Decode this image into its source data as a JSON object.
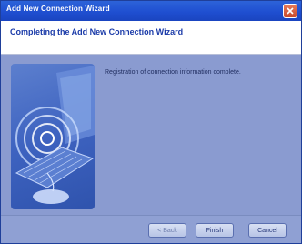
{
  "window": {
    "title": "Add New Connection Wizard"
  },
  "header": {
    "title": "Completing the Add New Connection Wizard"
  },
  "content": {
    "message": "Registration of connection information complete."
  },
  "buttons": {
    "back": "< Back",
    "finish": "Finish",
    "cancel": "Cancel"
  },
  "colors": {
    "titlebar": "#1f4fd1",
    "header_title": "#1a3aa8",
    "content_bg": "#8a9bd0"
  },
  "icons": {
    "close": "close-icon",
    "illustration": "network-computer-illustration"
  }
}
